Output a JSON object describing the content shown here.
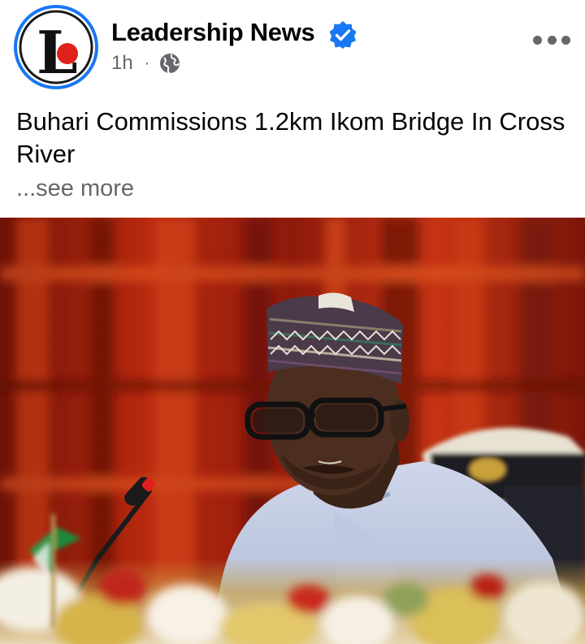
{
  "post": {
    "author": "Leadership News",
    "verified": true,
    "time": "1h",
    "separator": "·",
    "audience_icon": "globe-icon",
    "text": "Buhari Commissions 1.2km Ikom Bridge In Cross River",
    "see_more": "...see more",
    "more_icon": "more-horizontal-icon",
    "avatar_logo": "L"
  },
  "colors": {
    "accent": "#1877f2",
    "text_primary": "#050505",
    "text_secondary": "#65676b",
    "logo_red": "#e0201b"
  }
}
